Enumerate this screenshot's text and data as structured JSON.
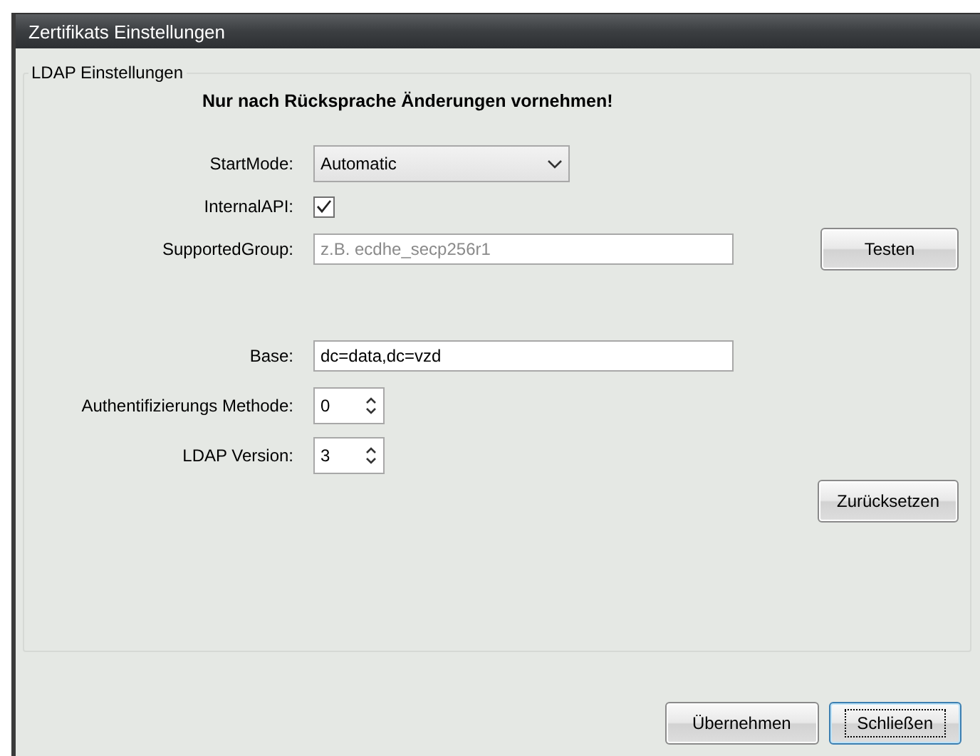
{
  "window": {
    "title": "Zertifikats Einstellungen"
  },
  "group": {
    "title": "LDAP Einstellungen",
    "warning": "Nur nach Rücksprache Änderungen vornehmen!",
    "fields": [
      {
        "kind": "combo",
        "label": "StartMode:",
        "value": "Automatic"
      },
      {
        "kind": "checkbox",
        "label": "InternalAPI:",
        "checked": true
      },
      {
        "kind": "text",
        "label": "SupportedGroup:",
        "placeholder": "z.B. ecdhe_secp256r1"
      }
    ],
    "test_button": "Testen",
    "ldap_fields": [
      {
        "kind": "text",
        "label": "Base:",
        "value": "dc=data,dc=vzd"
      },
      {
        "kind": "spin",
        "label": "Authentifizierungs Methode:",
        "value": "0"
      },
      {
        "kind": "spin",
        "label": "LDAP Version:",
        "value": "3"
      }
    ],
    "reset_button": "Zurücksetzen"
  },
  "buttons": [
    {
      "label": "Übernehmen",
      "default": false
    },
    {
      "label": "Schließen",
      "default": true
    }
  ]
}
